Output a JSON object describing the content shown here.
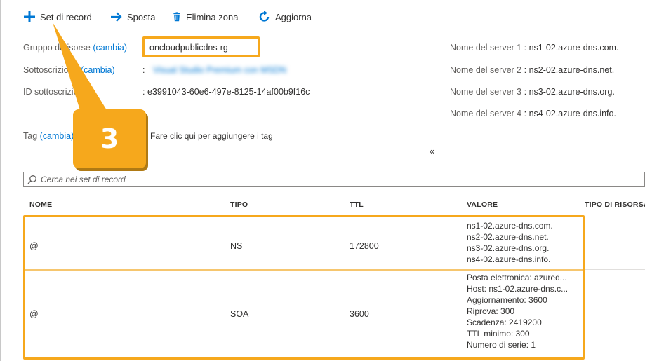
{
  "toolbar": {
    "add_label": "Set di record",
    "move_label": "Sposta",
    "delete_label": "Elimina zona",
    "refresh_label": "Aggiorna"
  },
  "essentials": {
    "resource_group_label": "Gruppo di risorse",
    "change_link": "(cambia)",
    "resource_group_value": "oncloudpublicdns-rg",
    "subscription_label": "Sottoscrizione",
    "subscription_value": "Visual Studio Premium con MSDN",
    "subscription_id_label": "ID sottoscrizione",
    "subscription_id_value": "e3991043-60e6-497e-8125-14af00b9f16c",
    "colon": ":",
    "name_servers": [
      {
        "label": "Nome del server 1",
        "value": "ns1-02.azure-dns.com."
      },
      {
        "label": "Nome del server 2",
        "value": "ns2-02.azure-dns.net."
      },
      {
        "label": "Nome del server 3",
        "value": "ns3-02.azure-dns.org."
      },
      {
        "label": "Nome del server 4",
        "value": "ns4-02.azure-dns.info."
      }
    ],
    "tag_label": "Tag",
    "tag_link": "Fare clic qui per aggiungere i tag",
    "collapse_glyph": "«"
  },
  "callout": {
    "number": "3"
  },
  "search": {
    "placeholder": "Cerca nei set di record"
  },
  "table": {
    "columns": [
      "NOME",
      "TIPO",
      "TTL",
      "VALORE",
      "TIPO DI RISORSA"
    ],
    "rows": [
      {
        "name": "@",
        "type": "NS",
        "ttl": "172800",
        "values": [
          "ns1-02.azure-dns.com.",
          "ns2-02.azure-dns.net.",
          "ns3-02.azure-dns.org.",
          "ns4-02.azure-dns.info."
        ]
      },
      {
        "name": "@",
        "type": "SOA",
        "ttl": "3600",
        "values": [
          "Posta elettronica: azured...",
          "Host: ns1-02.azure-dns.c...",
          "Aggiornamento: 3600",
          "Riprova: 300",
          "Scadenza: 2419200",
          "TTL minimo: 300",
          "Numero di serie: 1"
        ]
      }
    ]
  },
  "colors": {
    "accent": "#0078d4",
    "highlight": "#f6a81c"
  }
}
